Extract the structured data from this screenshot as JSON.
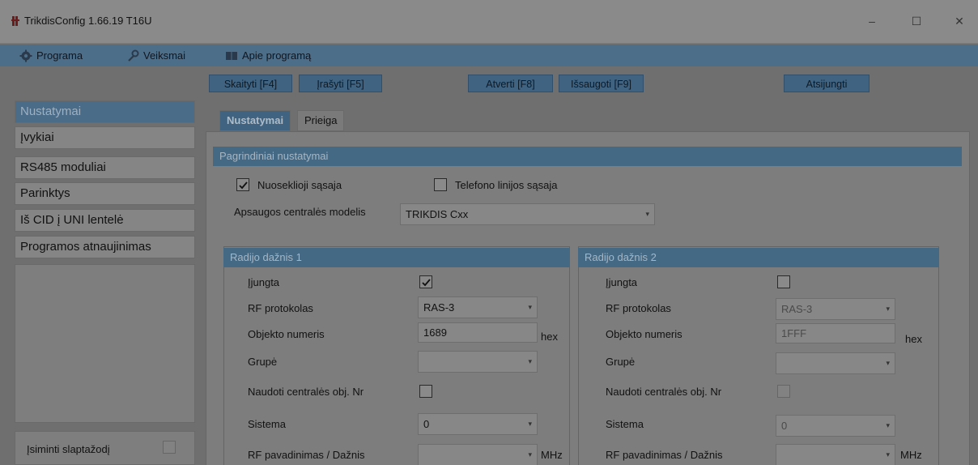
{
  "window": {
    "title": "TrikdisConfig 1.66.19   T16U",
    "minimize": "–",
    "maximize": "☐",
    "close": "✕"
  },
  "menu": {
    "programa": "Programa",
    "veiksmai": "Veiksmai",
    "apie": "Apie programą"
  },
  "toolbar": {
    "skaityti": "Skaityti [F4]",
    "irasyti": "Įrašyti [F5]",
    "atverti": "Atverti [F8]",
    "issaugoti": "Išsaugoti [F9]",
    "atsijungti": "Atsijungti"
  },
  "sidebar": {
    "items": [
      "Nustatymai",
      "Įvykiai",
      "RS485 moduliai",
      "Parinktys",
      "Iš CID į UNI lentelė",
      "Programos atnaujinimas"
    ],
    "active_index": 0,
    "remember_label": "Įsiminti slaptažodį",
    "remember_checked": false
  },
  "tabs": {
    "nustatymai": "Nustatymai",
    "prieiga": "Prieiga"
  },
  "main": {
    "section_title": "Pagrindiniai nustatymai",
    "serial_label": "Nuoseklioji sąsaja",
    "serial_checked": true,
    "phone_label": "Telefono linijos sąsaja",
    "phone_checked": false,
    "panel_model_label": "Apsaugos centralės modelis",
    "panel_model_value": "TRIKDIS Cxx"
  },
  "radio1": {
    "title": "Radijo dažnis 1",
    "enabled_label": "Įjungta",
    "enabled": true,
    "protocol_label": "RF protokolas",
    "protocol_value": "RAS-3",
    "object_label": "Objekto numeris",
    "object_value": "1689",
    "hex_unit": "hex",
    "group_label": "Grupė",
    "group_value": "",
    "use_panel_label": "Naudoti centralės obj. Nr",
    "use_panel": false,
    "system_label": "Sistema",
    "system_value": "0",
    "rf_name_label": "RF pavadinimas / Dažnis",
    "rf_name_value": "",
    "mhz_unit": "MHz"
  },
  "radio2": {
    "title": "Radijo dažnis 2",
    "enabled_label": "Įjungta",
    "enabled": false,
    "protocol_label": "RF protokolas",
    "protocol_value": "RAS-3",
    "object_label": "Objekto numeris",
    "object_value": "1FFF",
    "hex_unit": "hex",
    "group_label": "Grupė",
    "group_value": "",
    "use_panel_label": "Naudoti centralės obj. Nr",
    "use_panel": false,
    "system_label": "Sistema",
    "system_value": "0",
    "rf_name_label": "RF pavadinimas / Dažnis",
    "rf_name_value": "",
    "mhz_unit": "MHz"
  },
  "colors": {
    "accent": "#436985",
    "menubar": "#4d6e88",
    "overlay_gray": "#7d7d7d"
  }
}
